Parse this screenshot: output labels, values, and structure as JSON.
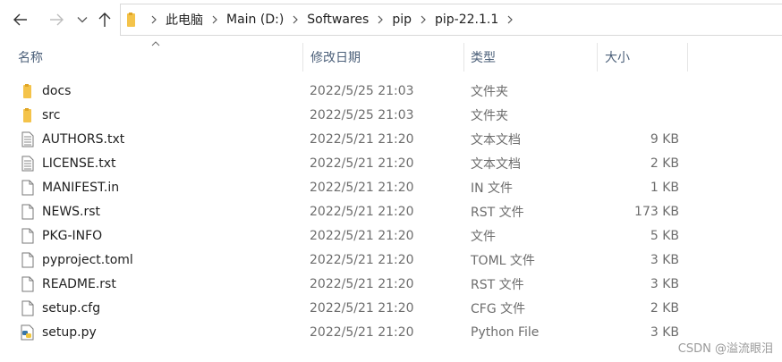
{
  "breadcrumb": [
    "此电脑",
    "Main (D:)",
    "Softwares",
    "pip",
    "pip-22.1.1"
  ],
  "columns": {
    "name": "名称",
    "date": "修改日期",
    "type": "类型",
    "size": "大小"
  },
  "files": [
    {
      "icon": "folder-icon",
      "name": "docs",
      "date": "2022/5/25 21:03",
      "type": "文件夹",
      "size": ""
    },
    {
      "icon": "folder-icon",
      "name": "src",
      "date": "2022/5/25 21:03",
      "type": "文件夹",
      "size": ""
    },
    {
      "icon": "text-file-icon",
      "name": "AUTHORS.txt",
      "date": "2022/5/21 21:20",
      "type": "文本文档",
      "size": "9 KB"
    },
    {
      "icon": "text-file-icon",
      "name": "LICENSE.txt",
      "date": "2022/5/21 21:20",
      "type": "文本文档",
      "size": "2 KB"
    },
    {
      "icon": "file-icon",
      "name": "MANIFEST.in",
      "date": "2022/5/21 21:20",
      "type": "IN 文件",
      "size": "1 KB"
    },
    {
      "icon": "file-icon",
      "name": "NEWS.rst",
      "date": "2022/5/21 21:20",
      "type": "RST 文件",
      "size": "173 KB"
    },
    {
      "icon": "file-icon",
      "name": "PKG-INFO",
      "date": "2022/5/21 21:20",
      "type": "文件",
      "size": "5 KB"
    },
    {
      "icon": "file-icon",
      "name": "pyproject.toml",
      "date": "2022/5/21 21:20",
      "type": "TOML 文件",
      "size": "3 KB"
    },
    {
      "icon": "file-icon",
      "name": "README.rst",
      "date": "2022/5/21 21:20",
      "type": "RST 文件",
      "size": "3 KB"
    },
    {
      "icon": "file-icon",
      "name": "setup.cfg",
      "date": "2022/5/21 21:20",
      "type": "CFG 文件",
      "size": "2 KB"
    },
    {
      "icon": "python-file-icon",
      "name": "setup.py",
      "date": "2022/5/21 21:20",
      "type": "Python File",
      "size": "3 KB"
    }
  ],
  "watermark": "CSDN @溢流眼泪",
  "colors": {
    "folder": "#f4c34a",
    "folder_dark": "#e0a526",
    "header_text": "#4c607a",
    "secondary_text": "#6d6d6d"
  }
}
